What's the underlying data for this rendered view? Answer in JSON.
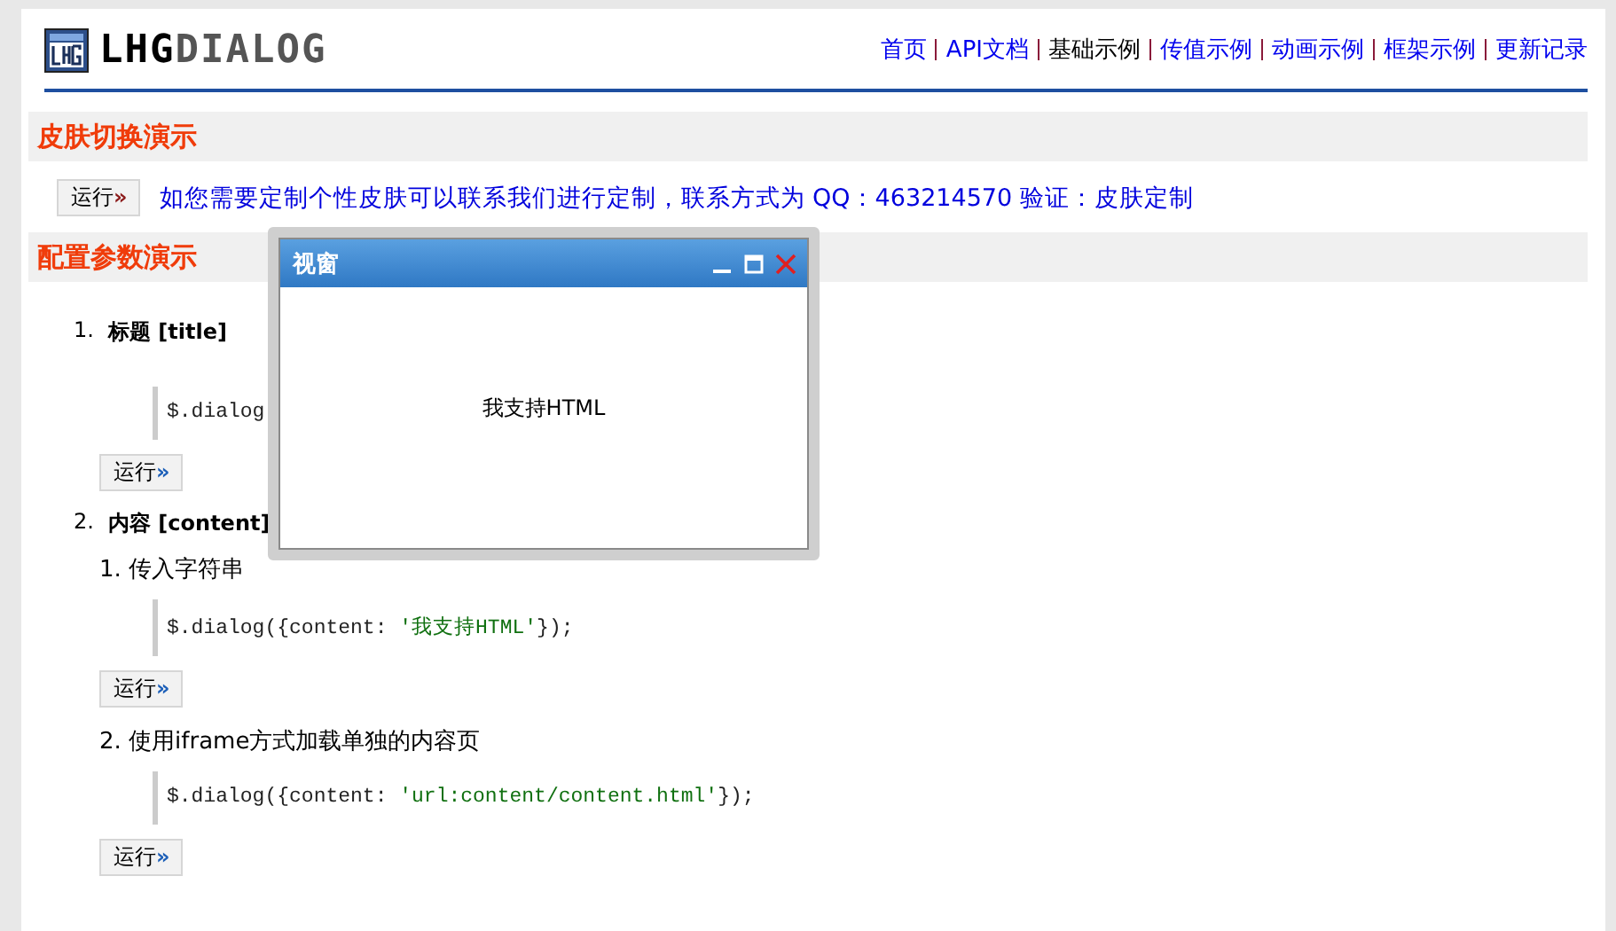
{
  "logo": {
    "strong": "LHG",
    "light": "DIALOG"
  },
  "nav": [
    {
      "label": "首页",
      "selected": false
    },
    {
      "label": "API文档",
      "selected": false
    },
    {
      "label": "基础示例",
      "selected": true
    },
    {
      "label": "传值示例",
      "selected": false
    },
    {
      "label": "动画示例",
      "selected": false
    },
    {
      "label": "框架示例",
      "selected": false
    },
    {
      "label": "更新记录",
      "selected": false
    }
  ],
  "skin_section": {
    "title": "皮肤切换演示",
    "button": {
      "label": "运行",
      "mark": "»"
    },
    "note": "如您需要定制个性皮肤可以联系我们进行定制，联系方式为 QQ：463214570 验证：皮肤定制"
  },
  "config_section": {
    "title": "配置参数演示",
    "items": [
      {
        "number": "1.",
        "title": "标题 [title]",
        "examples": [
          {
            "code": [
              {
                "kind": "plain",
                "text": "$.dialog"
              }
            ],
            "button": {
              "label": "运行",
              "mark": "»"
            }
          }
        ]
      },
      {
        "number": "2.",
        "title": "内容 [content]",
        "examples": [
          {
            "label": "1. 传入字符串",
            "code": [
              {
                "kind": "plain",
                "text": "$.dialog({content: "
              },
              {
                "kind": "string",
                "text": "'我支持HTML'"
              },
              {
                "kind": "plain",
                "text": "});"
              }
            ],
            "button": {
              "label": "运行",
              "mark": "»"
            }
          },
          {
            "label": "2. 使用iframe方式加载单独的内容页",
            "code": [
              {
                "kind": "plain",
                "text": "$.dialog({content: "
              },
              {
                "kind": "string",
                "text": "'url:content/content.html'"
              },
              {
                "kind": "plain",
                "text": "});"
              }
            ],
            "button": {
              "label": "运行",
              "mark": "»"
            }
          }
        ]
      }
    ]
  },
  "dialog": {
    "title": "视窗",
    "content": "我支持HTML"
  }
}
